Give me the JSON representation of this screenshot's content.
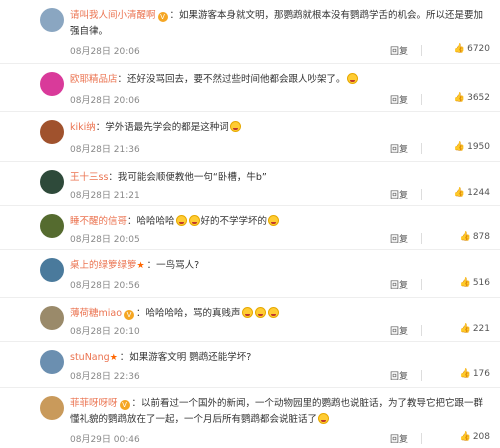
{
  "reply_label": "回复",
  "comments": [
    {
      "user": "请叫我人间小清醒啊",
      "badge": "V",
      "text": "：如果游客本身就文明，那鹦鹉就根本没有鹦鹉学舌的机会。所以还是要加强自律。",
      "time": "08月28日 20:06",
      "likes": "6720",
      "avatar_color": "#8aa6c1"
    },
    {
      "user": "欧耶精品店",
      "badge": "",
      "text": "：还好没骂回去，要不然过些时间他都会跟人吵架了。",
      "time": "08月28日 20:06",
      "likes": "3652",
      "avatar_color": "#d93a9a"
    },
    {
      "user": "kiki纳",
      "badge": "",
      "text": "：学外语最先学会的都是这种词",
      "time": "08月28日 21:36",
      "likes": "1950",
      "avatar_color": "#a0522d"
    },
    {
      "user": "王十三ss",
      "badge": "",
      "text": "：我可能会顺便教他一句“卧槽，牛b”",
      "time": "08月28日 21:21",
      "likes": "1244",
      "avatar_color": "#2e4a3a"
    },
    {
      "user": "睡不醒的信哥",
      "badge": "",
      "text": "：哈哈哈哈",
      "text2": "好的不学学坏的",
      "time": "08月28日 20:05",
      "likes": "878",
      "avatar_color": "#556b2f"
    },
    {
      "user": "桌上的绿箩绿箩",
      "badge": "★",
      "text": "：一鸟骂人?",
      "time": "08月28日 20:56",
      "likes": "516",
      "avatar_color": "#4a7a9c"
    },
    {
      "user": "薄荷糖miao",
      "badge": "V",
      "text": "：哈哈哈哈，骂的真贱声",
      "time": "08月28日 20:10",
      "likes": "221",
      "avatar_color": "#9a8a6a"
    },
    {
      "user": "stuNang",
      "badge": "★",
      "text": "：如果游客文明 鹦鹉还能学坏?",
      "time": "08月28日 22:36",
      "likes": "176",
      "avatar_color": "#6b8fb0"
    },
    {
      "user": "菲菲呀呀呀",
      "badge": "V",
      "text": "：以前看过一个国外的新闻，一个动物园里的鹦鹉也说脏话，为了教导它把它跟一群懂礼貌的鹦鹉放在了一起，一个月后所有鹦鹉都会说脏话了",
      "time": "08月29日 00:46",
      "likes": "208",
      "avatar_color": "#c99a5b"
    }
  ]
}
